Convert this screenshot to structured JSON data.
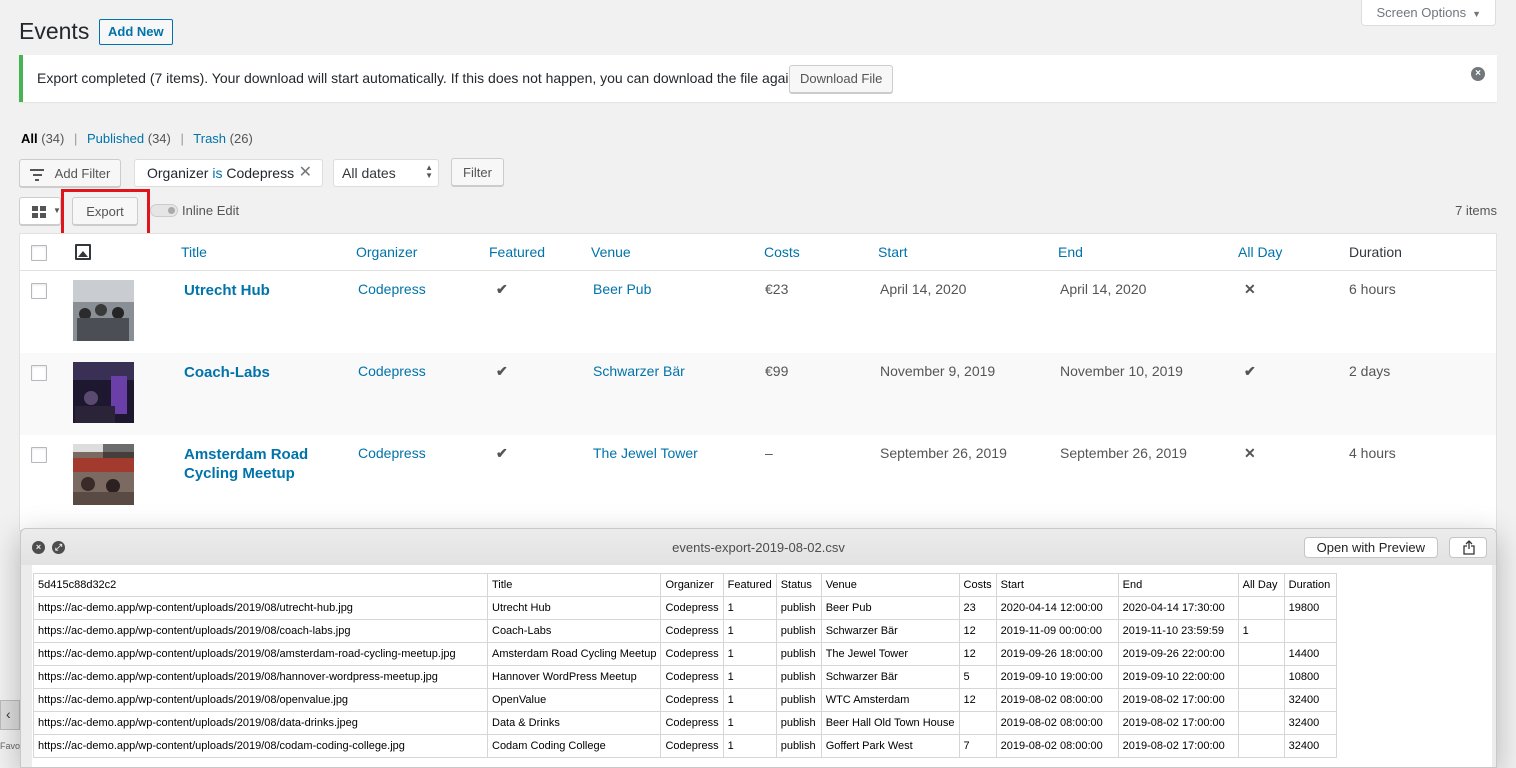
{
  "header": {
    "title": "Events",
    "add_new_label": "Add New",
    "screen_options_label": "Screen Options"
  },
  "notice": {
    "text": "Export completed (7 items). Your download will start automatically. If this does not happen, you can download the file again:",
    "download_label": "Download File",
    "status_color": "#46b450"
  },
  "views": {
    "all_label": "All",
    "all_count": "(34)",
    "published_label": "Published",
    "published_count": "(34)",
    "trash_label": "Trash",
    "trash_count": "(26)"
  },
  "filters": {
    "add_filter_label": "Add Filter",
    "chip_field": "Organizer",
    "chip_operator": "is",
    "chip_value": "Codepress",
    "dates_selected": "All dates",
    "filter_label": "Filter"
  },
  "toolbar": {
    "export_label": "Export",
    "inline_edit_label": "Inline Edit",
    "items_count": "7 items"
  },
  "table": {
    "columns": {
      "title": "Title",
      "organizer": "Organizer",
      "featured": "Featured",
      "venue": "Venue",
      "costs": "Costs",
      "start": "Start",
      "end": "End",
      "all_day": "All Day",
      "duration": "Duration"
    },
    "rows": [
      {
        "title": "Utrecht Hub",
        "organizer": "Codepress",
        "featured": "✔",
        "venue": "Beer Pub",
        "costs": "€23",
        "start": "April 14, 2020",
        "end": "April 14, 2020",
        "all_day": "✕",
        "duration": "6 hours"
      },
      {
        "title": "Coach-Labs",
        "organizer": "Codepress",
        "featured": "✔",
        "venue": "Schwarzer Bär",
        "costs": "€99",
        "start": "November 9, 2019",
        "end": "November 10, 2019",
        "all_day": "✔",
        "duration": "2 days"
      },
      {
        "title": "Amsterdam Road Cycling Meetup",
        "organizer": "Codepress",
        "featured": "✔",
        "venue": "The Jewel Tower",
        "costs": "–",
        "start": "September 26, 2019",
        "end": "September 26, 2019",
        "all_day": "✕",
        "duration": "4 hours"
      }
    ]
  },
  "preview": {
    "filename": "events-export-2019-08-02.csv",
    "open_with_label": "Open with Preview",
    "csv_header": [
      "5d415c88d32c2",
      "Title",
      "Organizer",
      "Featured",
      "Status",
      "Venue",
      "Costs",
      "Start",
      "End",
      "All Day",
      "Duration"
    ],
    "csv_rows": [
      [
        "https://ac-demo.app/wp-content/uploads/2019/08/utrecht-hub.jpg",
        "Utrecht Hub",
        "Codepress",
        "1",
        "publish",
        "Beer Pub",
        "23",
        "2020-04-14 12:00:00",
        "2020-04-14 17:30:00",
        "",
        "19800"
      ],
      [
        "https://ac-demo.app/wp-content/uploads/2019/08/coach-labs.jpg",
        "Coach-Labs",
        "Codepress",
        "1",
        "publish",
        "Schwarzer Bär",
        "12",
        "2019-11-09 00:00:00",
        "2019-11-10 23:59:59",
        "1",
        ""
      ],
      [
        "https://ac-demo.app/wp-content/uploads/2019/08/amsterdam-road-cycling-meetup.jpg",
        "Amsterdam Road Cycling Meetup",
        "Codepress",
        "1",
        "publish",
        "The Jewel Tower",
        "12",
        "2019-09-26 18:00:00",
        "2019-09-26 22:00:00",
        "",
        "14400"
      ],
      [
        "https://ac-demo.app/wp-content/uploads/2019/08/hannover-wordpress-meetup.jpg",
        "Hannover WordPress Meetup",
        "Codepress",
        "1",
        "publish",
        "Schwarzer Bär",
        "5",
        "2019-09-10 19:00:00",
        "2019-09-10 22:00:00",
        "",
        "10800"
      ],
      [
        "https://ac-demo.app/wp-content/uploads/2019/08/openvalue.jpg",
        "OpenValue",
        "Codepress",
        "1",
        "publish",
        "WTC Amsterdam",
        "12",
        "2019-08-02 08:00:00",
        "2019-08-02 17:00:00",
        "",
        "32400"
      ],
      [
        "https://ac-demo.app/wp-content/uploads/2019/08/data-drinks.jpeg",
        "Data & Drinks",
        "Codepress",
        "1",
        "publish",
        "Beer Hall Old Town House",
        "",
        "2019-08-02 08:00:00",
        "2019-08-02 17:00:00",
        "",
        "32400"
      ],
      [
        "https://ac-demo.app/wp-content/uploads/2019/08/codam-coding-college.jpg",
        "Codam Coding College",
        "Codepress",
        "1",
        "publish",
        "Goffert Park West",
        "7",
        "2019-08-02 08:00:00",
        "2019-08-02 17:00:00",
        "",
        "32400"
      ]
    ]
  },
  "misc": {
    "sidebar_fragment": "Favo"
  }
}
